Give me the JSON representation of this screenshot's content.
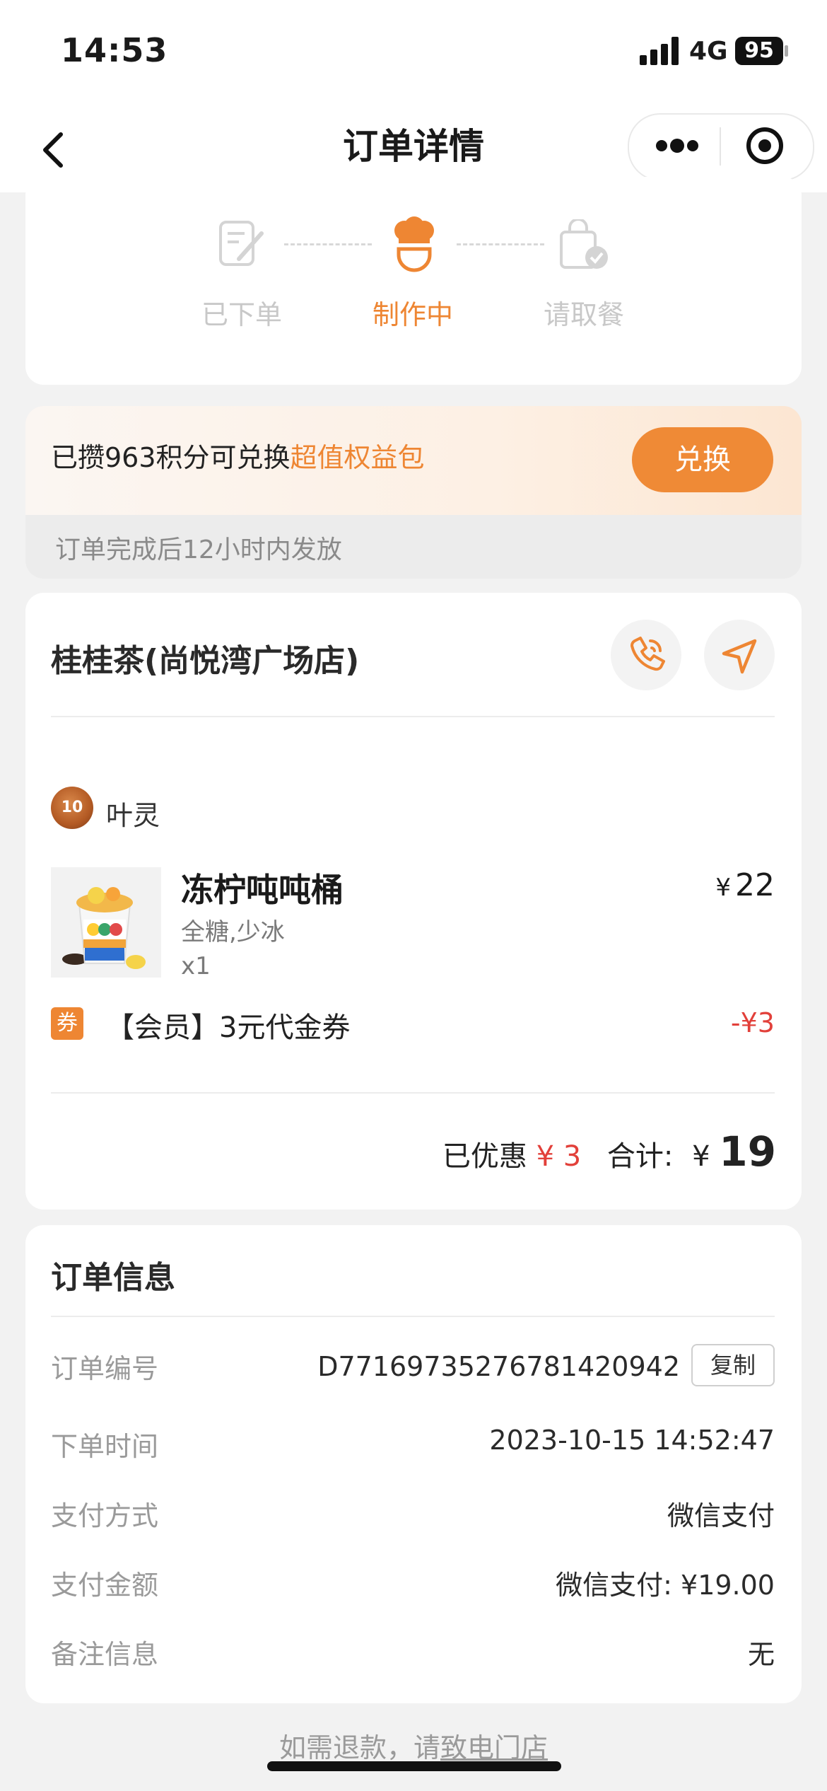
{
  "status_bar": {
    "time": "14:53",
    "network": "4G",
    "battery": "95"
  },
  "nav": {
    "title": "订单详情"
  },
  "progress": {
    "steps": [
      {
        "label": "已下单",
        "state": "done"
      },
      {
        "label": "制作中",
        "state": "active"
      },
      {
        "label": "请取餐",
        "state": "pending"
      }
    ]
  },
  "points": {
    "text": "已攒963积分可兑换",
    "link": "超值权益包",
    "button": "兑换",
    "note": "订单完成后12小时内发放"
  },
  "shop": {
    "name": "桂桂茶(尚悦湾广场店)",
    "user": {
      "name": "叶灵",
      "avatar_text": "10"
    },
    "item": {
      "name": "冻柠吨吨桶",
      "options": "全糖,少冰",
      "qty": "x1",
      "currency": "¥",
      "price": "22"
    },
    "coupon": {
      "tag": "券",
      "text": "【会员】3元代金券",
      "amount": "-¥3"
    },
    "summary": {
      "discount_label": "已优惠",
      "discount": "¥ 3",
      "total_label": "合计:",
      "currency": "¥",
      "total": "19"
    }
  },
  "order_info": {
    "title": "订单信息",
    "order_no_label": "订单编号",
    "order_no": "D7716973527678142094​2",
    "copy_label": "复制",
    "time_label": "下单时间",
    "time": "2023-10-15 14:52:47",
    "pay_method_label": "支付方式",
    "pay_method": "微信支付",
    "pay_amount_label": "支付金额",
    "pay_amount": "微信支付: ¥19.00",
    "remark_label": "备注信息",
    "remark": "无"
  },
  "footer": {
    "text": "如需退款，请",
    "link": "致电门店"
  },
  "colors": {
    "accent": "#ee8633",
    "discount": "#e2403a"
  }
}
